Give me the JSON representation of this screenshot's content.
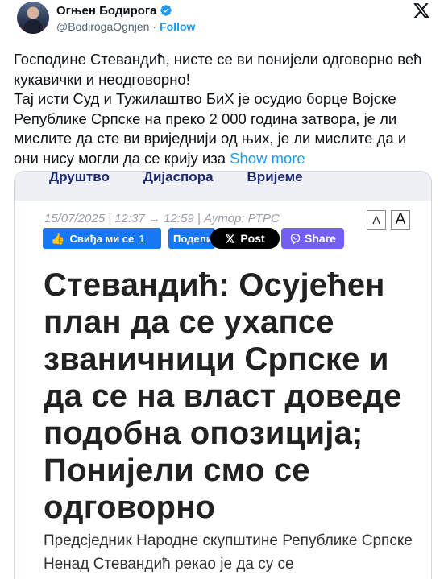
{
  "author": {
    "display_name": "Огњен Бодирога",
    "handle": "@BodirogaOgnjen",
    "separator": "·",
    "follow_label": "Follow"
  },
  "tweet": {
    "line1": "Господине Стевандић, нисте се ви понијели одговорно већ кукавички и неодговорно!",
    "line2": "Тај исти Суд и Тужилаштво БиХ је осудио борце Војске Републике Српске на преко 2 000 година затвора, је ли мислите да сте ви вриједнији од њих, је ли мислите да и они нису могли да се крију иза ",
    "show_more": "Show more"
  },
  "article": {
    "nav": [
      "Друштво",
      "Дијаспора",
      "Вријеме"
    ],
    "meta": "15/07/2025 |  12:37  →  12:59 | Аутор: РТРС",
    "font_small": "A",
    "font_large": "A",
    "like_label": "Свиђа ми се",
    "like_count": "1",
    "share_fb_label": "Подели",
    "x_post_label": "Post",
    "viber_label": "Share",
    "headline": "Стевандић: Осујећен план да се ухапсе званичници Српске и да се на власт доведе подобна опозиција; Понијели смо се одговорно",
    "lede": "Предсједник Народне скупштине Републике Српске Ненад Стевандић рекао је да су се"
  },
  "icons": {
    "verified": "verified-badge-icon",
    "x_logo": "x-logo-icon",
    "thumb": "thumbs-up-icon",
    "viber": "viber-icon"
  },
  "colors": {
    "link": "#1d9bf0",
    "facebook": "#1877f2",
    "viber": "#7360f2",
    "nav_text": "#1e2a6e"
  }
}
